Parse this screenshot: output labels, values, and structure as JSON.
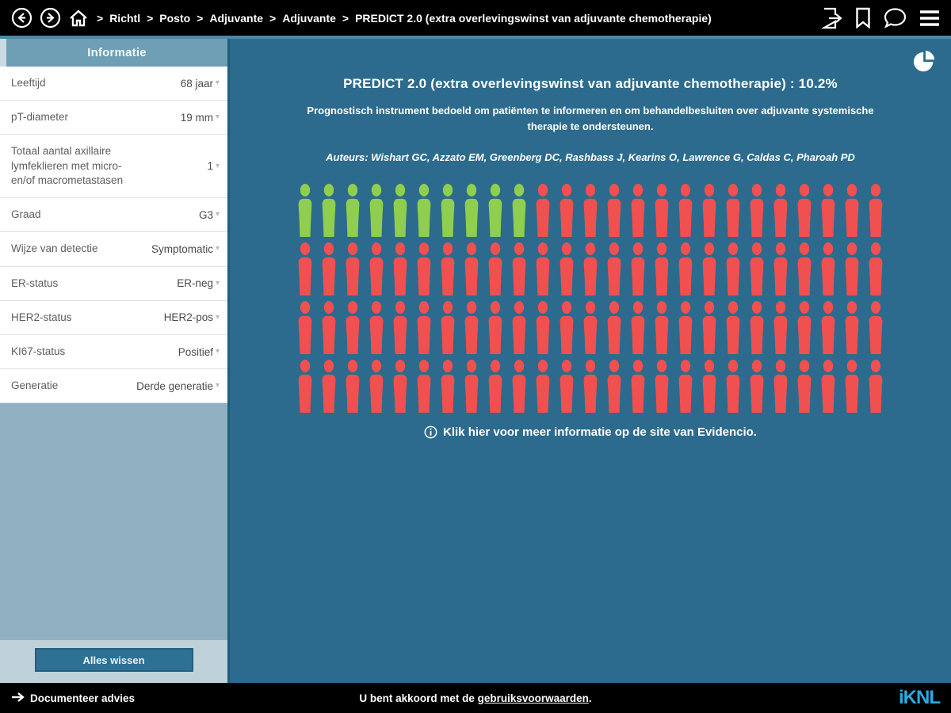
{
  "topbar": {
    "nav_icons": [
      "back",
      "forward",
      "home"
    ],
    "breadcrumbs": [
      "Richtl",
      "Posto",
      "Adjuvante",
      "Adjuvante",
      "PREDICT 2.0 (extra overlevingswinst van adjuvante chemotherapie)"
    ],
    "right_icons": [
      "export-document",
      "bookmark",
      "comment",
      "menu"
    ]
  },
  "sidebar": {
    "header": "Informatie",
    "fields": [
      {
        "label": "Leeftijd",
        "value": "68 jaar"
      },
      {
        "label": "pT-diameter",
        "value": "19 mm"
      },
      {
        "label": "Totaal aantal axillaire lymfeklieren met micro- en/of macrometastasen",
        "value": "1"
      },
      {
        "label": "Graad",
        "value": "G3"
      },
      {
        "label": "Wijze van detectie",
        "value": "Symptomatic"
      },
      {
        "label": "ER-status",
        "value": "ER-neg"
      },
      {
        "label": "HER2-status",
        "value": "HER2-pos"
      },
      {
        "label": "KI67-status",
        "value": "Positief"
      },
      {
        "label": "Generatie",
        "value": "Derde generatie"
      }
    ],
    "clear_button": "Alles wissen"
  },
  "main": {
    "title": "PREDICT 2.0 (extra overlevingswinst van adjuvante chemotherapie) : 10.2%",
    "subtitle": "Prognostisch instrument bedoeld om patiënten te informeren en om behandelbesluiten over adjuvante systemische therapie te ondersteunen.",
    "authors": "Auteurs: Wishart GC, Azzato EM, Greenberg DC, Rashbass J, Kearins O, Lawrence G, Caldas C, Pharoah PD",
    "info_link": "Klik hier voor meer informatie op de site van Evidencio."
  },
  "chart_data": {
    "type": "pictogram",
    "title": "PREDICT 2.0 (extra overlevingswinst van adjuvante chemotherapie) : 10.2%",
    "value_percent": 10.2,
    "total_icons": 100,
    "green_icons": 10,
    "red_icons": 90,
    "rows": 4,
    "cols": 25,
    "green_color": "#8FCE4E",
    "red_color": "#F05050",
    "legend_position": "none",
    "grid": "off"
  },
  "bottombar": {
    "left_link": "Documenteer advies",
    "agreement_text": "U bent akkoord met de ",
    "agreement_link": "gebruiksvoorwaarden",
    "agreement_suffix": ".",
    "logo": "iKNL",
    "logo_color": "#29ABE2"
  },
  "colors": {
    "topbar_bg": "#000000",
    "main_bg": "#2C6B8D",
    "sidebar_header_bg": "#6F9FB4",
    "sidebar_fill_bg": "#8FB1C2",
    "sidebar_footer_bg": "#BFD2DA",
    "clear_button_bg": "#2D7195",
    "top_accent_line": "#4C88A7"
  }
}
